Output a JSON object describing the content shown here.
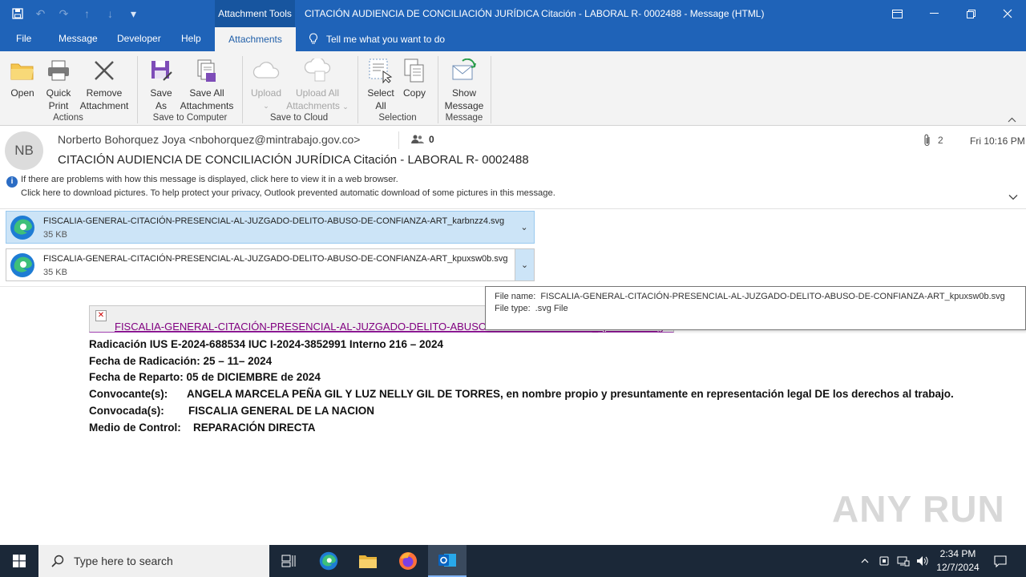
{
  "window": {
    "context_tab": "Attachment Tools",
    "title": "CITACIÓN AUDIENCIA DE CONCILIACIÓN JURÍDICA Citación - LABORAL R- 0002488  -  Message (HTML)"
  },
  "menu": {
    "file": "File",
    "message": "Message",
    "developer": "Developer",
    "help": "Help",
    "attachments": "Attachments",
    "tell_me": "Tell me what you want to do"
  },
  "ribbon": {
    "open": "Open",
    "quick_print_1": "Quick",
    "quick_print_2": "Print",
    "remove_1": "Remove",
    "remove_2": "Attachment",
    "actions_group": "Actions",
    "save_as_1": "Save",
    "save_as_2": "As",
    "save_all_1": "Save All",
    "save_all_2": "Attachments",
    "save_computer_group": "Save to Computer",
    "upload": "Upload",
    "upload_all_1": "Upload All",
    "upload_all_2": "Attachments",
    "save_cloud_group": "Save to Cloud",
    "select_all_1": "Select",
    "select_all_2": "All",
    "copy": "Copy",
    "selection_group": "Selection",
    "show_message_1": "Show",
    "show_message_2": "Message",
    "message_group": "Message"
  },
  "email": {
    "avatar_initials": "NB",
    "sender": "Norberto Bohorquez Joya <nbohorquez@mintrabajo.gov.co>",
    "people_count": "0",
    "attachment_count": "2",
    "date": "Fri 10:16 PM",
    "subject": "CITACIÓN AUDIENCIA DE CONCILIACIÓN JURÍDICA Citación - LABORAL R- 0002488",
    "info_line1": "If there are problems with how this message is displayed, click here to view it in a web browser.",
    "info_line2": "Click here to download pictures. To help protect your privacy, Outlook prevented automatic download of some pictures in this message."
  },
  "attachments": [
    {
      "name": "FISCALIA-GENERAL-CITACIÓN-PRESENCIAL-AL-JUZGADO-DELITO-ABUSO-DE-CONFIANZA-ART_karbnzz4.svg",
      "size": "35 KB"
    },
    {
      "name": "FISCALIA-GENERAL-CITACIÓN-PRESENCIAL-AL-JUZGADO-DELITO-ABUSO-DE-CONFIANZA-ART_kpuxsw0b.svg",
      "size": "35 KB"
    }
  ],
  "tooltip": {
    "file_name_label": "File name:",
    "file_name": "FISCALIA-GENERAL-CITACIÓN-PRESENCIAL-AL-JUZGADO-DELITO-ABUSO-DE-CONFIANZA-ART_kpuxsw0b.svg",
    "file_type_label": "File type:",
    "file_type": ".svg File"
  },
  "body": {
    "image_link": "FISCALIA-GENERAL-CITACIÓN-PRESENCIAL-AL-JUZGADO-DELITO-ABUSO-DE-CONFIANZA-ART_kpuxsw0b.svg",
    "line1": "Radicación IUS E-2024-688534 IUC I-2024-3852991  Interno 216 – 2024",
    "line2": "Fecha de Radicación: 25 – 11– 2024",
    "line3": "Fecha de Reparto: 05 de DICIEMBRE de 2024",
    "convocante_label": "Convocante(s):",
    "convocante_value": "ANGELA MARCELA PEÑA GIL Y LUZ NELLY GIL DE TORRES, en nombre propio y presuntamente en representación legal DE los derechos al trabajo.",
    "convocada_label": "Convocada(s):",
    "convocada_value": "FISCALIA GENERAL DE LA NACION",
    "medio_label": "Medio de Control:",
    "medio_value": "REPARACIÓN DIRECTA"
  },
  "watermark": "ANY RUN",
  "taskbar": {
    "search_placeholder": "Type here to search",
    "time": "2:34 PM",
    "date": "12/7/2024"
  }
}
